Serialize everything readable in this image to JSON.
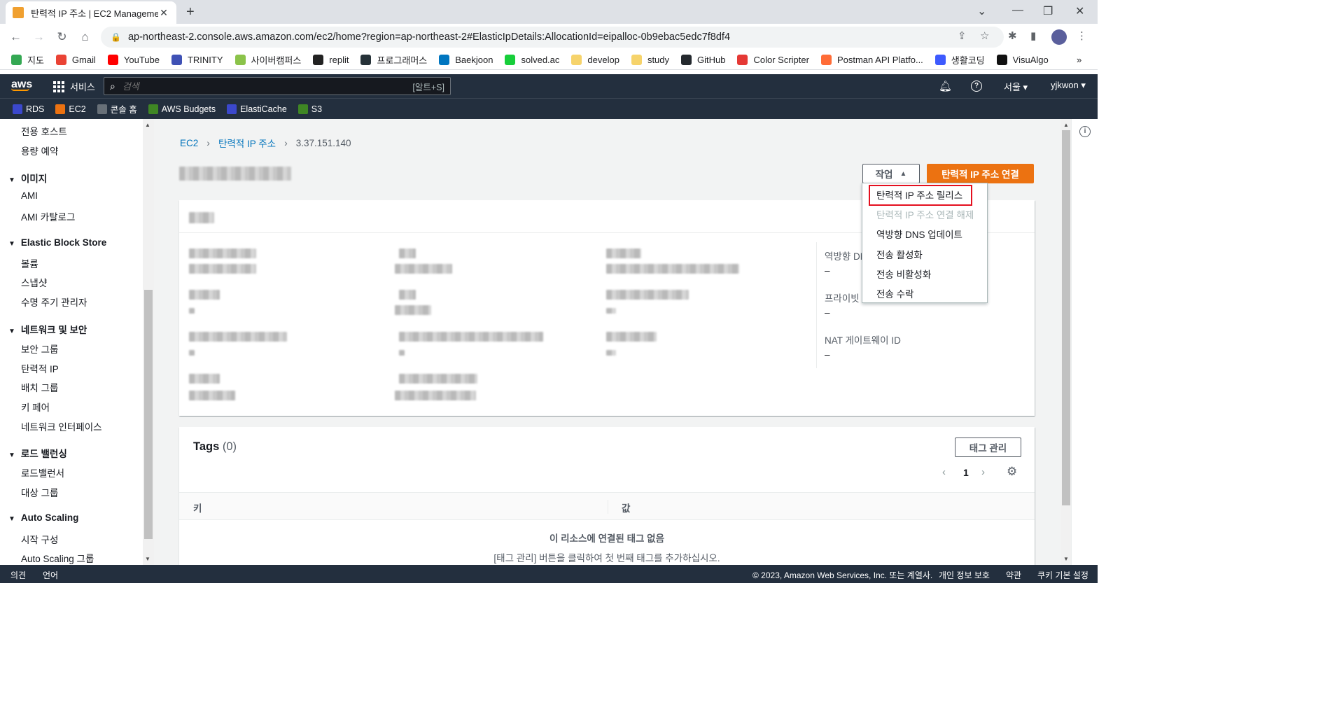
{
  "browser": {
    "tab_title": "탄력적 IP 주소 | EC2 Manageme",
    "url": "ap-northeast-2.console.aws.amazon.com/ec2/home?region=ap-northeast-2#ElasticIpDetails:AllocationId=eipalloc-0b9ebac5edc7f8df4",
    "bookmarks": [
      {
        "label": "지도",
        "color": "#34a853"
      },
      {
        "label": "Gmail",
        "color": "#ea4335"
      },
      {
        "label": "YouTube",
        "color": "#ff0000"
      },
      {
        "label": "TRINITY",
        "color": "#3f51b5"
      },
      {
        "label": "사이버캠퍼스",
        "color": "#8bc34a"
      },
      {
        "label": "replit",
        "color": "#222222"
      },
      {
        "label": "프로그래머스",
        "color": "#263238"
      },
      {
        "label": "Baekjoon",
        "color": "#0076c0"
      },
      {
        "label": "solved.ac",
        "color": "#17ce3a"
      },
      {
        "label": "develop",
        "color": "#f6d36b"
      },
      {
        "label": "study",
        "color": "#f6d36b"
      },
      {
        "label": "GitHub",
        "color": "#24292e"
      },
      {
        "label": "Color Scripter",
        "color": "#e53935"
      },
      {
        "label": "Postman API Platfo...",
        "color": "#ff6c37"
      },
      {
        "label": "생활코딩",
        "color": "#3d5afe"
      },
      {
        "label": "VisuAlgo",
        "color": "#111111"
      }
    ],
    "overflow": "»"
  },
  "aws": {
    "logo": "aws",
    "services_label": "서비스",
    "search_placeholder": "검색",
    "search_shortcut": "[알트+S]",
    "region": "서울 ▾",
    "user": "yjkwon ▾",
    "favorites": [
      {
        "label": "RDS",
        "color": "#3b48cc"
      },
      {
        "label": "EC2",
        "color": "#ec7211"
      },
      {
        "label": "콘솔 홈",
        "color": "#687078"
      },
      {
        "label": "AWS Budgets",
        "color": "#3f8624"
      },
      {
        "label": "ElastiCache",
        "color": "#3b48cc"
      },
      {
        "label": "S3",
        "color": "#3f8624"
      }
    ]
  },
  "sidebar": {
    "items_top": [
      "전용 호스트",
      "용량 예약"
    ],
    "section_images": "이미지",
    "images_items": [
      "AMI",
      "AMI 카탈로그"
    ],
    "section_ebs": "Elastic Block Store",
    "ebs_items": [
      "볼륨",
      "스냅샷",
      "수명 주기 관리자"
    ],
    "section_network": "네트워크 및 보안",
    "network_items": [
      "보안 그룹",
      "탄력적 IP",
      "배치 그룹",
      "키 페어",
      "네트워크 인터페이스"
    ],
    "section_lb": "로드 밸런싱",
    "lb_items": [
      "로드밸런서",
      "대상 그룹"
    ],
    "section_as": "Auto Scaling",
    "as_items": [
      "시작 구성",
      "Auto Scaling 그룹"
    ]
  },
  "breadcrumb": {
    "root": "EC2",
    "section": "탄력적 IP 주소",
    "current": "3.37.151.140"
  },
  "actions": {
    "actions_label": "작업",
    "associate_label": "탄력적 IP 주소 연결"
  },
  "details": {
    "reverse_dns_label": "역방향 DN",
    "reverse_dns_value": "–",
    "private_label": "프라이빗",
    "private_value": "–",
    "nat_label": "NAT 게이트웨이 ID",
    "nat_value": "–"
  },
  "dropdown": {
    "items": [
      "탄력적 IP 주소 릴리스",
      "탄력적 IP 주소 연결 해제",
      "역방향 DNS 업데이트",
      "전송 활성화",
      "전송 비활성화",
      "전송 수락"
    ],
    "disabled_index": 1,
    "highlighted_index": 0
  },
  "tags": {
    "title": "Tags",
    "count": "(0)",
    "manage_label": "태그 관리",
    "page": "1",
    "col_key": "키",
    "col_value": "값",
    "empty_title": "이 리소스에 연결된 태그 없음",
    "empty_sub": "[태그 관리] 버튼을 클릭하여 첫 번째 태그를 추가하십시오."
  },
  "footer": {
    "feedback": "의견",
    "language": "언어",
    "copyright": "© 2023, Amazon Web Services, Inc. 또는 계열사.",
    "privacy": "개인 정보 보호",
    "terms": "약관",
    "cookies": "쿠키 기본 설정"
  },
  "colors": {
    "aws_header": "#232f3e",
    "primary": "#ec7211",
    "link": "#0073bb",
    "highlight_box": "#e4101f"
  }
}
